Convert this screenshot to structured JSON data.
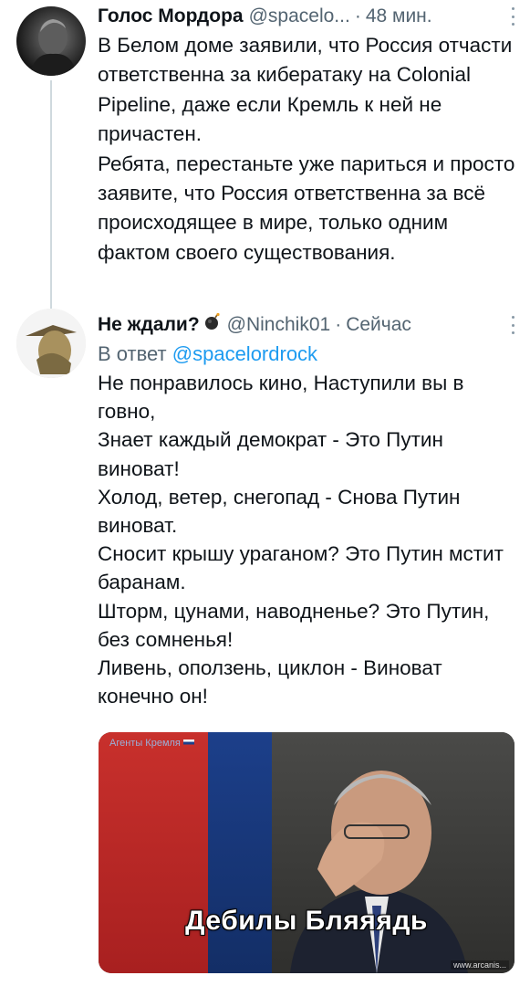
{
  "tweet1": {
    "name": "Голос Мордора",
    "handle": "@spacelo...",
    "time": "48 мин.",
    "paragraphs": [
      "В Белом доме заявили, что Россия отчасти ответственна за кибератаку на Colonial Pipeline, даже если Кремль к ней не причастен.",
      "Ребята, перестаньте уже париться и просто заявите, что Россия ответственна за всё происходящее в мире, только одним фактом своего существования."
    ]
  },
  "tweet2": {
    "name": "Не ждали?",
    "handle": "@Ninchik01",
    "time": "Сейчас",
    "reply_prefix": "В ответ",
    "reply_handle": "@spacelordrock",
    "paragraphs": [
      "Не понравилось кино, Наступили вы в говно,",
      "Знает каждый демократ - Это Путин виноват!",
      "Холод, ветер, снегопад - Снова Путин виноват.",
      "Сносит крышу ураганом? Это Путин мстит баранам.",
      "Шторм, цунами, наводненье? Это Путин, без сомненья!",
      "Ливень, оползень, циклон - Виноват конечно он!"
    ]
  },
  "media": {
    "watermark": "Агенты Кремля",
    "caption": "Дебилы Бляяядь",
    "site_mark": "www.arcanis..."
  },
  "icons": {
    "bomb": "bomb-icon",
    "more": "more-icon"
  }
}
